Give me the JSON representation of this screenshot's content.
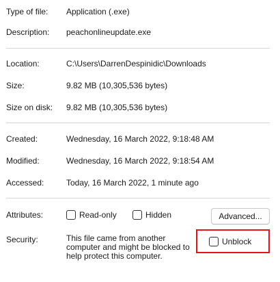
{
  "general": {
    "type_label": "Type of file:",
    "type_value": "Application (.exe)",
    "description_label": "Description:",
    "description_value": "peachonlineupdate.exe"
  },
  "location": {
    "location_label": "Location:",
    "location_value": "C:\\Users\\DarrenDespinidic\\Downloads",
    "size_label": "Size:",
    "size_value": "9.82 MB (10,305,536 bytes)",
    "size_on_disk_label": "Size on disk:",
    "size_on_disk_value": "9.82 MB (10,305,536 bytes)"
  },
  "dates": {
    "created_label": "Created:",
    "created_value": "Wednesday, 16 March 2022, 9:18:48 AM",
    "modified_label": "Modified:",
    "modified_value": "Wednesday, 16 March 2022, 9:18:54 AM",
    "accessed_label": "Accessed:",
    "accessed_value": "Today, 16 March 2022, 1 minute ago"
  },
  "attributes": {
    "label": "Attributes:",
    "read_only_label": "Read-only",
    "read_only_checked": false,
    "hidden_label": "Hidden",
    "hidden_checked": false,
    "advanced_label": "Advanced..."
  },
  "security": {
    "label": "Security:",
    "line1": "This file came from another",
    "line2": "computer and might be blocked to",
    "line3": "help protect this computer.",
    "unblock_label": "Unblock",
    "unblock_checked": false,
    "highlight_color": "#e3141b"
  }
}
